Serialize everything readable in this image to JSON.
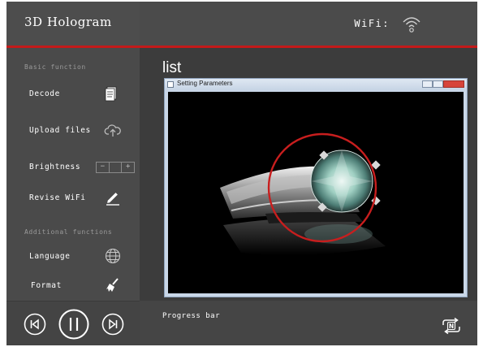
{
  "app": {
    "title": "3D Hologram"
  },
  "header": {
    "wifi_label": "WiFi:",
    "wifi_icon": "wifi-icon"
  },
  "sidebar": {
    "basic_section": "Basic function",
    "basic_items": [
      {
        "label": "Decode",
        "icon": "document-icon"
      },
      {
        "label": "Upload files",
        "icon": "cloud-upload-icon"
      },
      {
        "label": "Brightness",
        "icon": "brightness-stepper",
        "minus": "−",
        "plus": "+"
      },
      {
        "label": "Revise WiFi",
        "icon": "pencil-icon"
      }
    ],
    "additional_section": "Additional functions",
    "additional_items": [
      {
        "label": "Language",
        "icon": "globe-icon"
      },
      {
        "label": "Format",
        "icon": "broom-icon"
      }
    ]
  },
  "main": {
    "list_label": "list",
    "window": {
      "title": "Setting Parameters"
    },
    "progress_label": "Progress bar"
  },
  "player": {
    "prev_icon": "skip-previous-icon",
    "pause_icon": "pause-icon",
    "next_icon": "skip-next-icon",
    "loop_icon": "loop-n-icon",
    "loop_badge": "N"
  },
  "colors": {
    "accent_red": "#c41a1a",
    "panel": "#4a4a4a",
    "content_bg": "#3c3c3c"
  }
}
